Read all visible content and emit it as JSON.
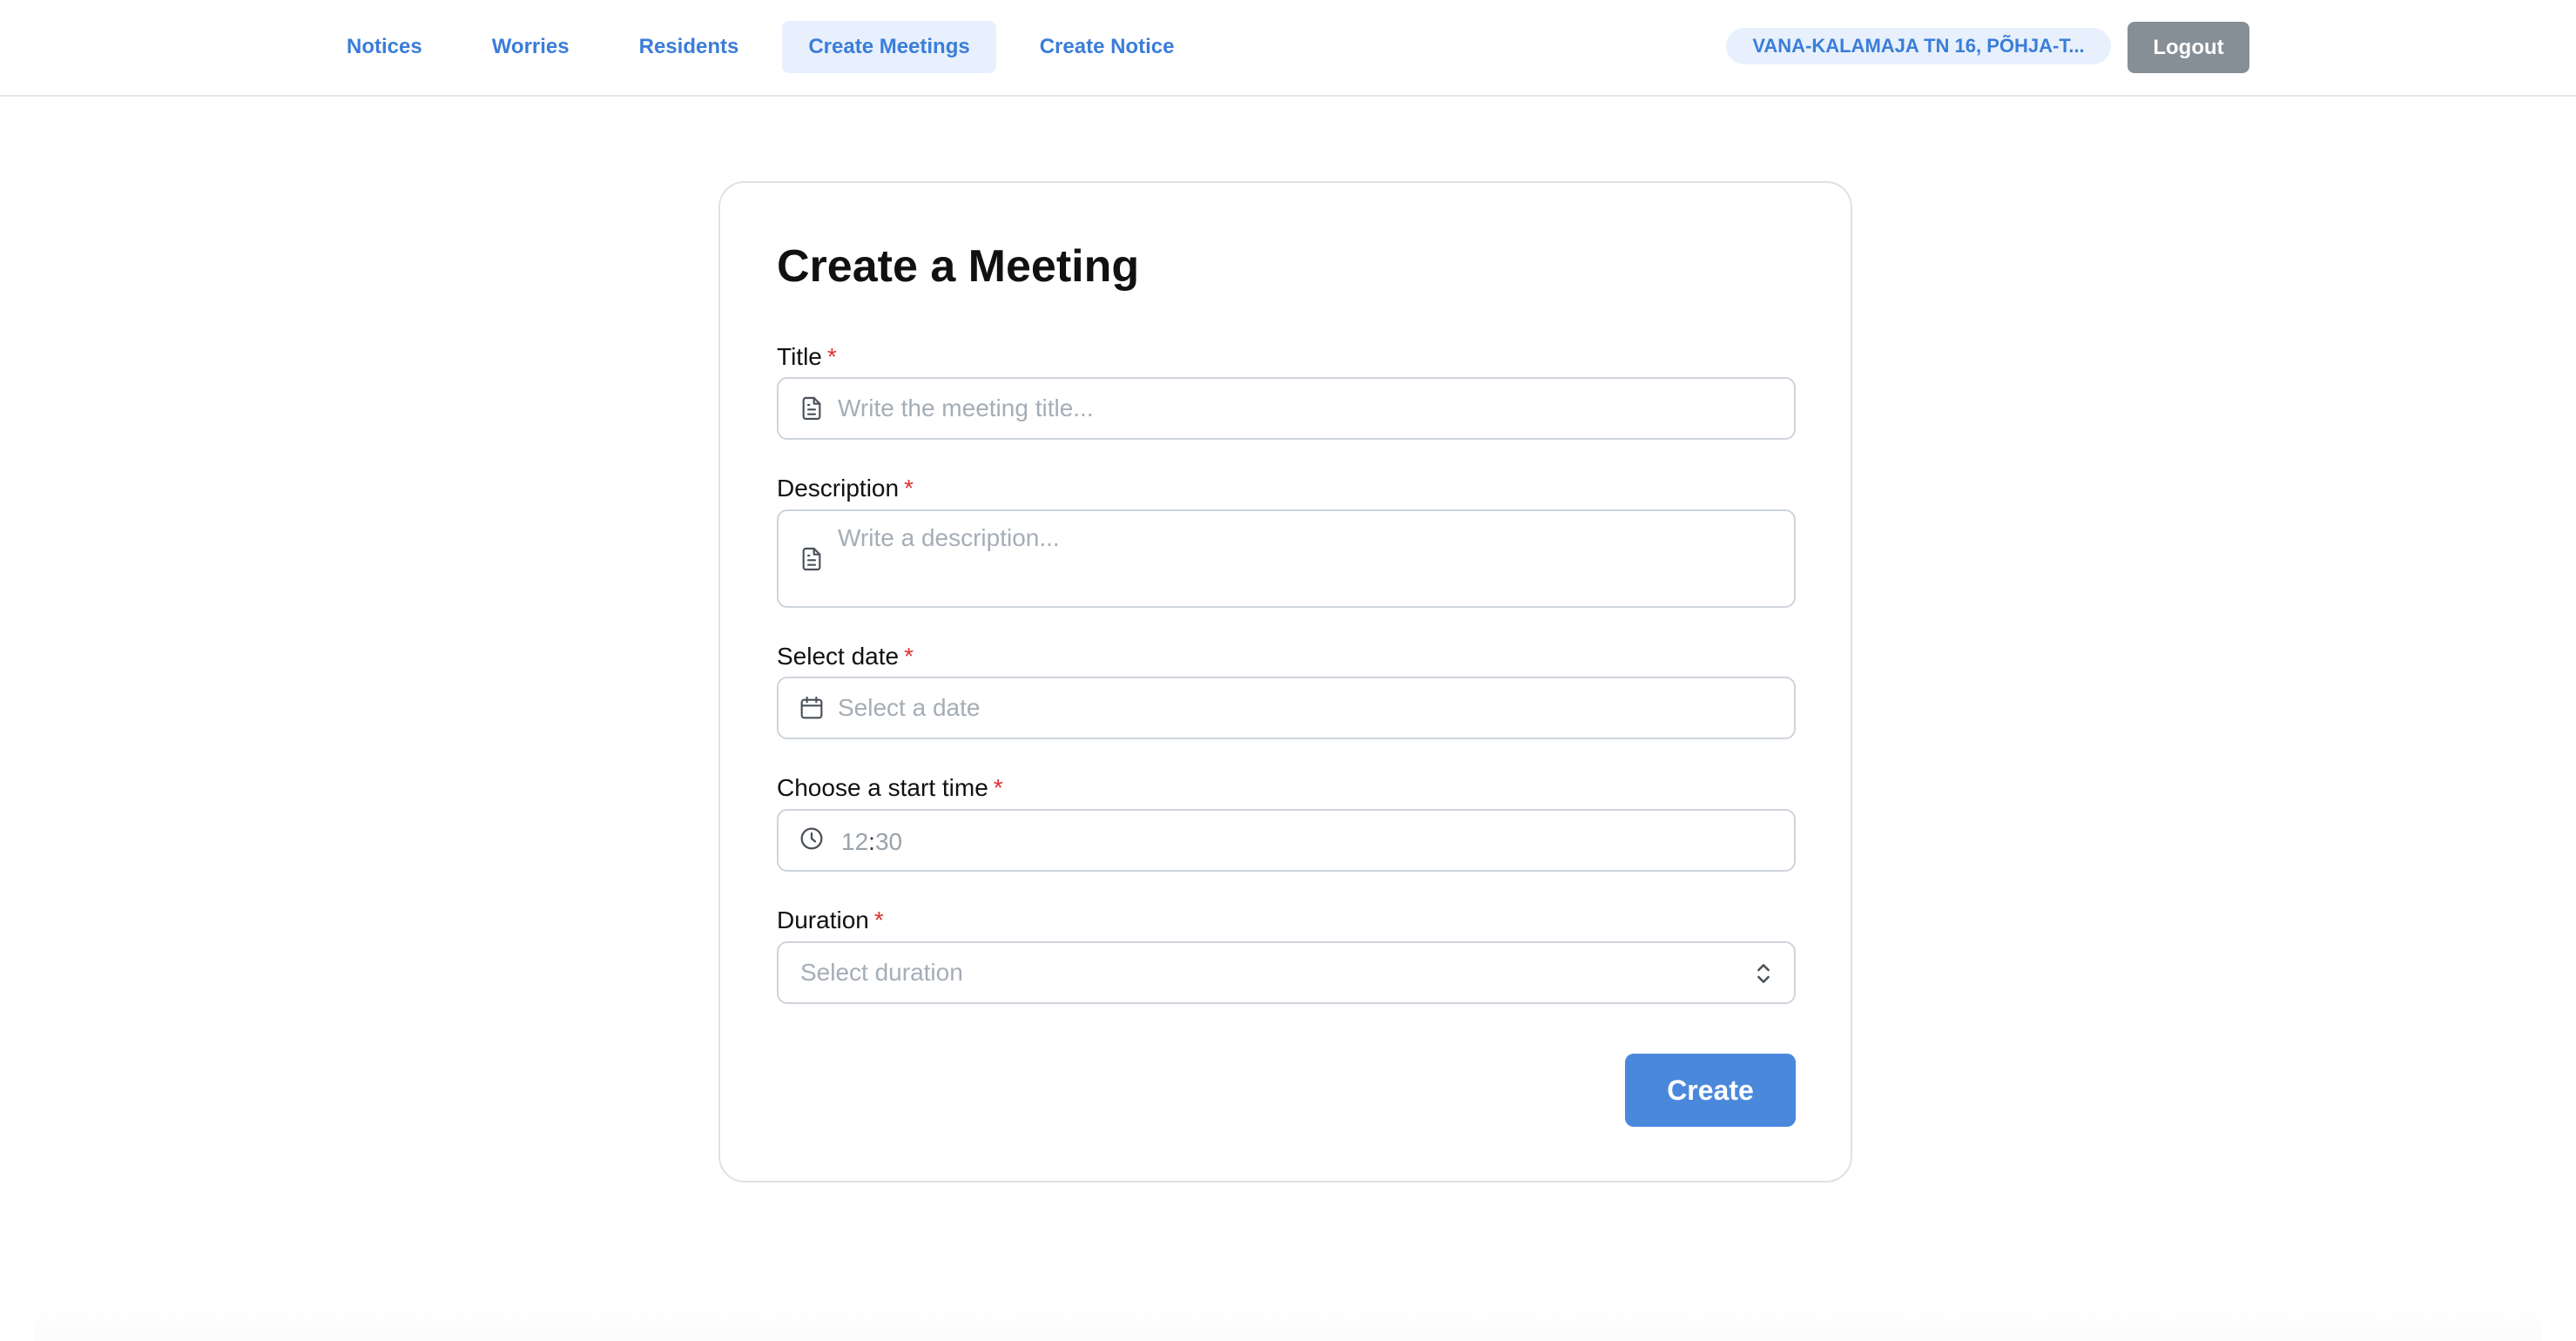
{
  "nav": {
    "items": [
      {
        "label": "Notices",
        "active": false
      },
      {
        "label": "Worries",
        "active": false
      },
      {
        "label": "Residents",
        "active": false
      },
      {
        "label": "Create Meetings",
        "active": true
      },
      {
        "label": "Create Notice",
        "active": false
      }
    ]
  },
  "header": {
    "address": "VANA-KALAMAJA TN 16, PÕHJA-T...",
    "logout_label": "Logout"
  },
  "form": {
    "title": "Create a Meeting",
    "required_mark": "*",
    "fields": {
      "title": {
        "label": "Title",
        "placeholder": "Write the meeting title...",
        "icon": "document-icon"
      },
      "description": {
        "label": "Description",
        "placeholder": "Write a description...",
        "icon": "document-icon"
      },
      "date": {
        "label": "Select date",
        "placeholder": "Select a date",
        "icon": "calendar-icon"
      },
      "start_time": {
        "label": "Choose a start time",
        "hours": "12",
        "separator": ":",
        "minutes": "30",
        "icon": "clock-icon"
      },
      "duration": {
        "label": "Duration",
        "placeholder": "Select duration",
        "icon": "chevron-up-down-icon"
      }
    },
    "submit_label": "Create"
  },
  "colors": {
    "accent": "#3b7dd8",
    "nav_active_bg": "#e7f0fc",
    "button_primary": "#4a88dc",
    "button_secondary": "#868e96",
    "required": "#e03131"
  }
}
